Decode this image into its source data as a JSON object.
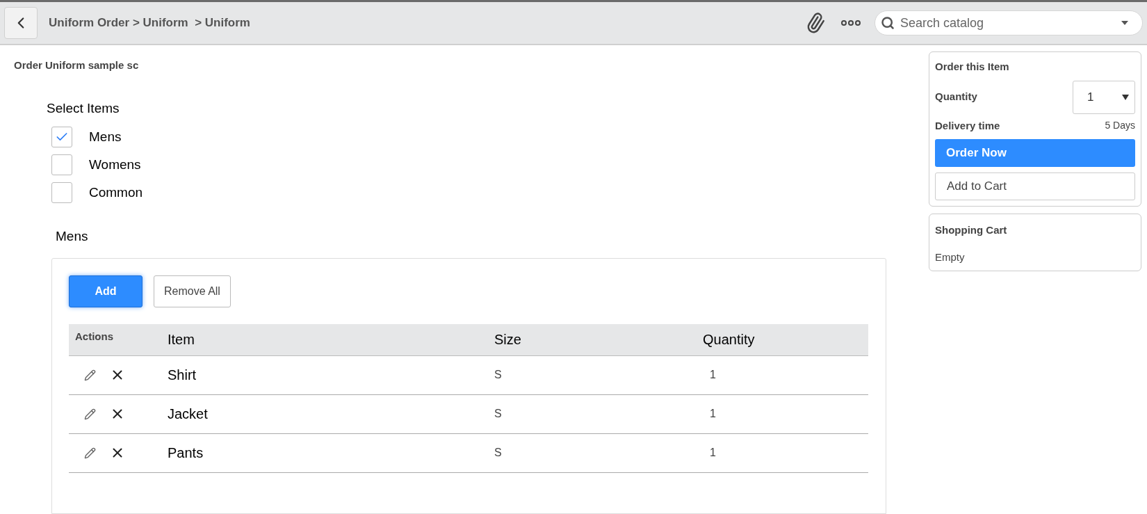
{
  "header": {
    "breadcrumb": "Uniform Order > Uniform  > Uniform",
    "search": {
      "placeholder": "Search catalog"
    }
  },
  "page_title": "Order Uniform sample sc",
  "select_items": {
    "label": "Select Items",
    "options": [
      {
        "label": "Mens",
        "checked": true
      },
      {
        "label": "Womens",
        "checked": false
      },
      {
        "label": "Common",
        "checked": false
      }
    ]
  },
  "section_label": "Mens",
  "buttons": [
    "Add",
    "Remove All"
  ],
  "table": {
    "columns": [
      "Actions",
      "Item",
      "Size",
      "Quantity"
    ],
    "rows": [
      [
        "",
        "Shirt",
        "S",
        "1"
      ],
      [
        "",
        "Jacket",
        "S",
        "1"
      ],
      [
        "",
        "Pants",
        "S",
        "1"
      ]
    ]
  },
  "order_panel": {
    "title": "Order this Item",
    "quantity_label": "Quantity",
    "quantity_value": "1",
    "delivery_label": "Delivery time",
    "delivery_value": "5 Days",
    "order_button": "Order Now",
    "cart_button": "Add to Cart"
  },
  "cart_panel": {
    "title": "Shopping Cart",
    "status": "Empty"
  }
}
